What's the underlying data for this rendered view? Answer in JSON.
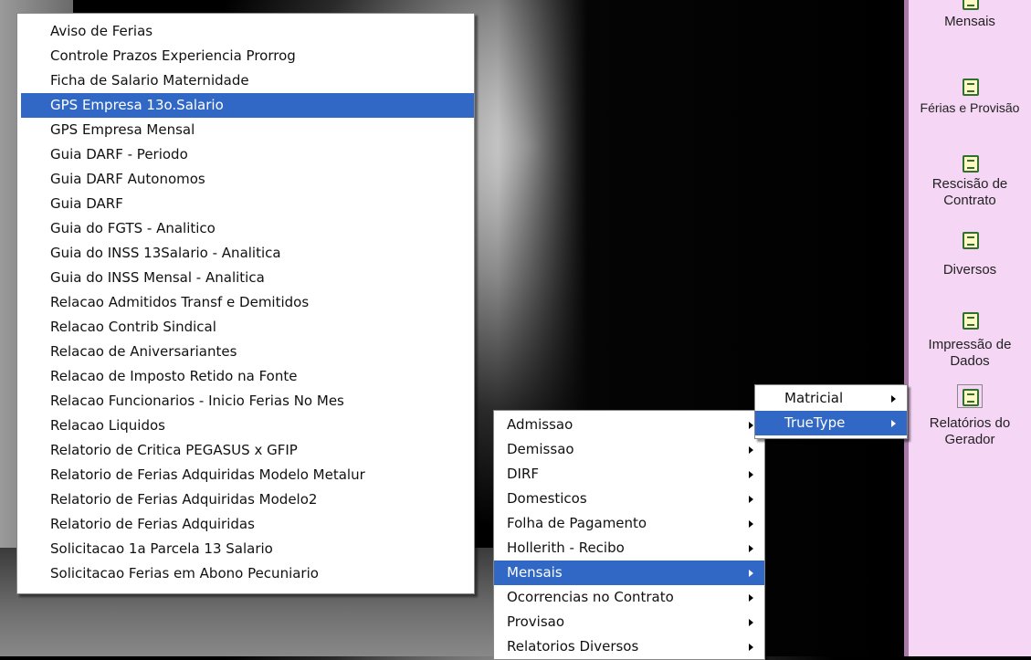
{
  "sidebar": {
    "items": [
      {
        "label": "Mensais",
        "icon": "report-icon"
      },
      {
        "label": "Férias e Provisão",
        "icon": "report-icon"
      },
      {
        "label": "Rescisão de Contrato",
        "icon": "report-icon"
      },
      {
        "label": "Diversos",
        "icon": "report-icon"
      },
      {
        "label": "Impressão de Dados",
        "icon": "report-icon"
      },
      {
        "label": "Relatórios do Gerador",
        "icon": "report-icon"
      }
    ]
  },
  "reports_menu": {
    "items": [
      "Aviso de Ferias",
      "Controle Prazos Experiencia Prorrog",
      "Ficha de  Salario Maternidade",
      "GPS Empresa 13o.Salario",
      "GPS Empresa Mensal",
      "Guia DARF - Periodo",
      "Guia DARF Autonomos",
      "Guia DARF",
      "Guia do FGTS - Analitico",
      "Guia do INSS 13Salario - Analitica",
      "Guia do INSS Mensal - Analitica",
      "Relacao Admitidos Transf e Demitidos",
      "Relacao Contrib Sindical",
      "Relacao de Aniversariantes",
      "Relacao de Imposto Retido na Fonte",
      "Relacao Funcionarios - Inicio Ferias No Mes",
      "Relacao Liquidos",
      "Relatorio de Critica PEGASUS x GFIP",
      "Relatorio de Ferias Adquiridas Modelo Metalur",
      "Relatorio de Ferias Adquiridas Modelo2",
      "Relatorio de Ferias Adquiridas",
      "Solicitacao 1a Parcela 13 Salario",
      "Solicitacao Ferias em Abono Pecuniario"
    ],
    "selected": "GPS Empresa 13o.Salario"
  },
  "categories_menu": {
    "items": [
      "Admissao",
      "Demissao",
      "DIRF",
      "Domesticos",
      "Folha de Pagamento",
      "Hollerith - Recibo",
      "Mensais",
      "Ocorrencias no Contrato",
      "Provisao",
      "Relatorios Diversos"
    ],
    "selected": "Mensais"
  },
  "format_menu": {
    "items": [
      "Matricial",
      "TrueType"
    ],
    "selected": "TrueType"
  },
  "colors": {
    "highlight": "#3168c5",
    "sidebar_bg": "#f5d7f5",
    "sidebar_border": "#a77aa7"
  }
}
